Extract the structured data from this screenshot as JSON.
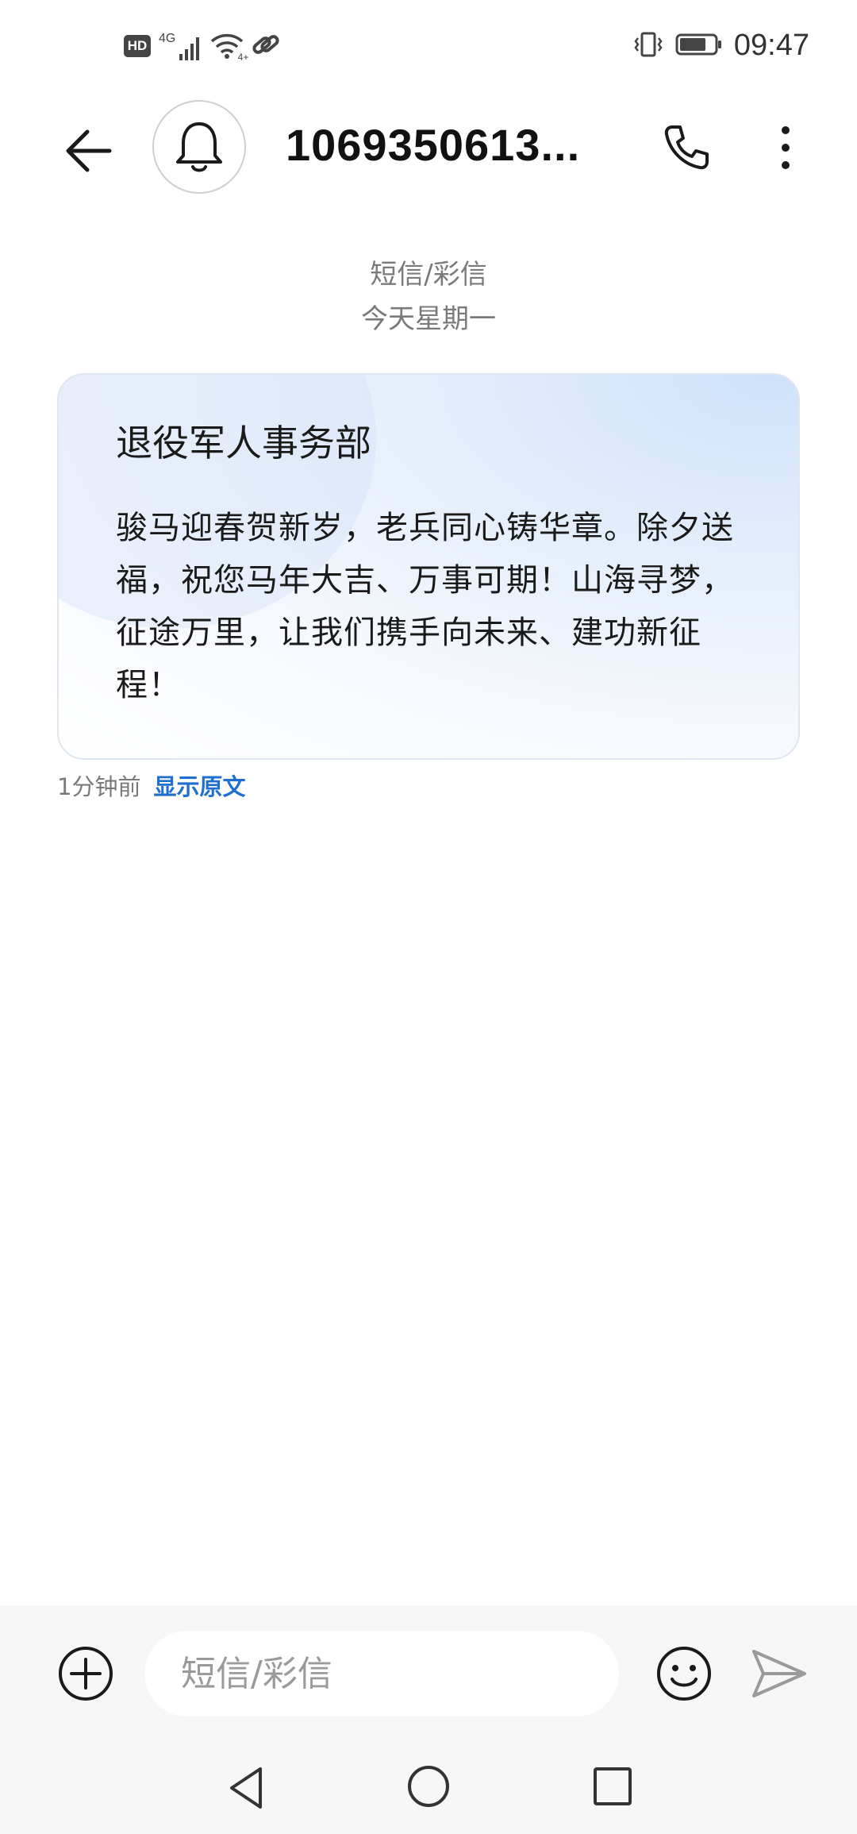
{
  "status_bar": {
    "hd_label": "HD",
    "network_label": "4G",
    "wifi_sub_label": "4+",
    "time": "09:47",
    "icons": [
      "hd-icon",
      "signal-icon",
      "wifi-icon",
      "link-icon",
      "vibrate-icon",
      "battery-icon"
    ]
  },
  "app_bar": {
    "contact_title": "1069350613...",
    "icons": [
      "back-arrow-icon",
      "bell-icon",
      "phone-icon",
      "more-vertical-icon"
    ]
  },
  "conversation": {
    "channel_label": "短信/彩信",
    "date_label": "今天星期一"
  },
  "message": {
    "sender": "退役军人事务部",
    "body": "骏马迎春贺新岁，老兵同心铸华章。除夕送福，祝您马年大吉、万事可期！山海寻梦，征途万里，让我们携手向未来、建功新征程！",
    "time": "1分钟前",
    "show_original_label": "显示原文"
  },
  "composer": {
    "placeholder": "短信/彩信",
    "value": "",
    "icons": [
      "add-icon",
      "emoji-icon",
      "send-icon"
    ]
  },
  "nav_bar": {
    "icons": [
      "nav-back-icon",
      "nav-home-icon",
      "nav-recent-icon"
    ]
  },
  "colors": {
    "link": "#1f6fd1",
    "card_gradient": "#cfe2fb",
    "muted_text": "#7a7a7a"
  }
}
